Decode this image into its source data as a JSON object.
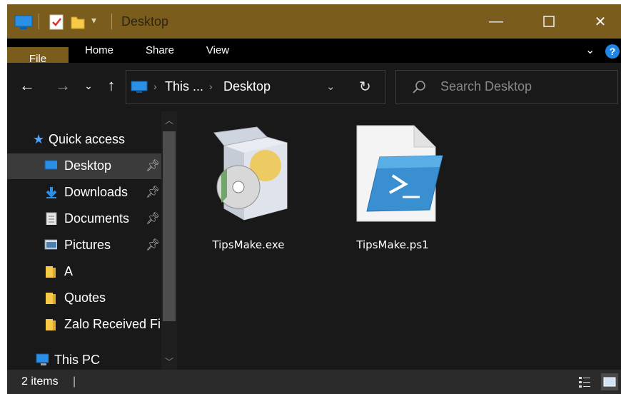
{
  "window": {
    "title": "Desktop"
  },
  "ribbon": {
    "tabs": [
      "File",
      "Home",
      "Share",
      "View"
    ]
  },
  "address": {
    "segments": [
      "This ...",
      "Desktop"
    ]
  },
  "search": {
    "placeholder": "Search Desktop"
  },
  "nav": {
    "quick_access": "Quick access",
    "items": [
      {
        "label": "Desktop",
        "icon": "desktop-icon",
        "pinned": true
      },
      {
        "label": "Downloads",
        "icon": "download-icon",
        "pinned": true
      },
      {
        "label": "Documents",
        "icon": "documents-icon",
        "pinned": true
      },
      {
        "label": "Pictures",
        "icon": "pictures-icon",
        "pinned": true
      },
      {
        "label": "A",
        "icon": "folder-icon",
        "pinned": false
      },
      {
        "label": "Quotes",
        "icon": "folder-icon",
        "pinned": false
      },
      {
        "label": "Zalo Received Fi",
        "icon": "folder-icon",
        "pinned": false
      }
    ],
    "this_pc": "This PC"
  },
  "files": [
    {
      "name": "TipsMake.exe",
      "icon": "installer-icon"
    },
    {
      "name": "TipsMake.ps1",
      "icon": "powershell-script-icon"
    }
  ],
  "status": {
    "items_text": "2 items"
  },
  "colors": {
    "accent": "#7a5c1c",
    "background": "#191919",
    "selection": "#3b3b3b"
  }
}
